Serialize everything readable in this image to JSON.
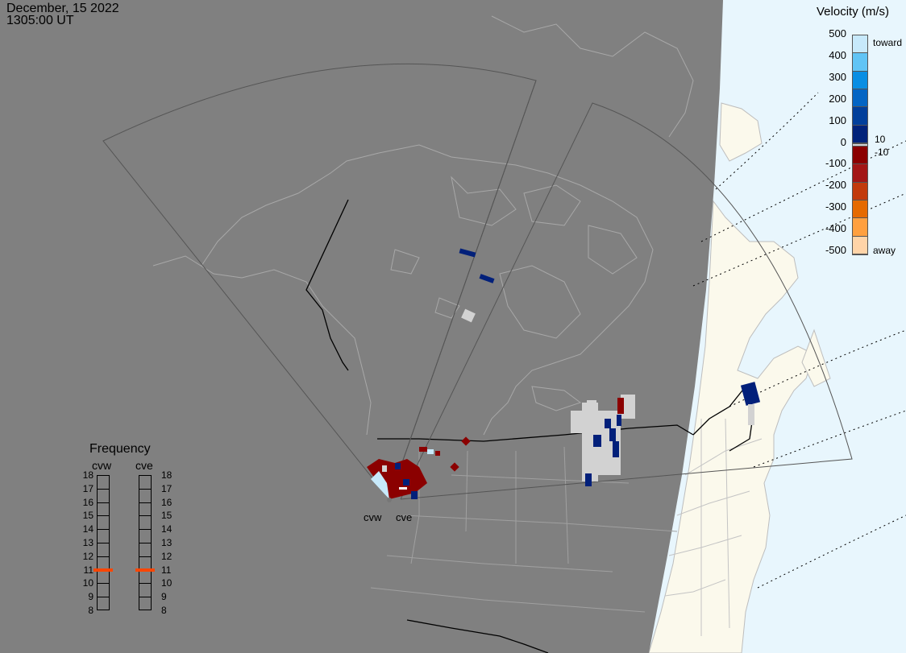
{
  "header": {
    "date": "December, 15 2022",
    "time": "1305:00 UT"
  },
  "colorbar": {
    "title": "Velocity (m/s)",
    "toward_label": "toward",
    "away_label": "away",
    "ticks": [
      "500",
      "400",
      "300",
      "200",
      "100",
      "0",
      "-100",
      "-200",
      "-300",
      "-400",
      "-500"
    ],
    "threshold_pos": "10",
    "threshold_neg": "-10",
    "colors_toward": [
      "#c7e9fb",
      "#61c4f5",
      "#0a8ee3",
      "#0465c4",
      "#023f9b",
      "#01227a"
    ],
    "colors_away": [
      "#8b0000",
      "#a31616",
      "#c23a0c",
      "#e56a00",
      "#ffa040",
      "#ffd4a8"
    ],
    "ground_scatter_color": "#d2d2d2"
  },
  "frequency_panel": {
    "title": "Frequency",
    "radars": [
      "cvw",
      "cve"
    ],
    "scale": [
      "18",
      "17",
      "16",
      "15",
      "14",
      "13",
      "12",
      "11",
      "10",
      "9",
      "8"
    ],
    "cvw_mhz": 11,
    "cve_mhz": 11,
    "marker_color": "#ff4500"
  },
  "radar_sites": [
    "cvw",
    "cve"
  ],
  "map": {
    "night_color": "#808080",
    "ocean_day_color": "#e8f6fd",
    "land_day_color": "#fbf9ec",
    "coast_night_color": "#a9a9a9",
    "coast_day_color": "#bdbdbd",
    "terminator_visible": true
  }
}
